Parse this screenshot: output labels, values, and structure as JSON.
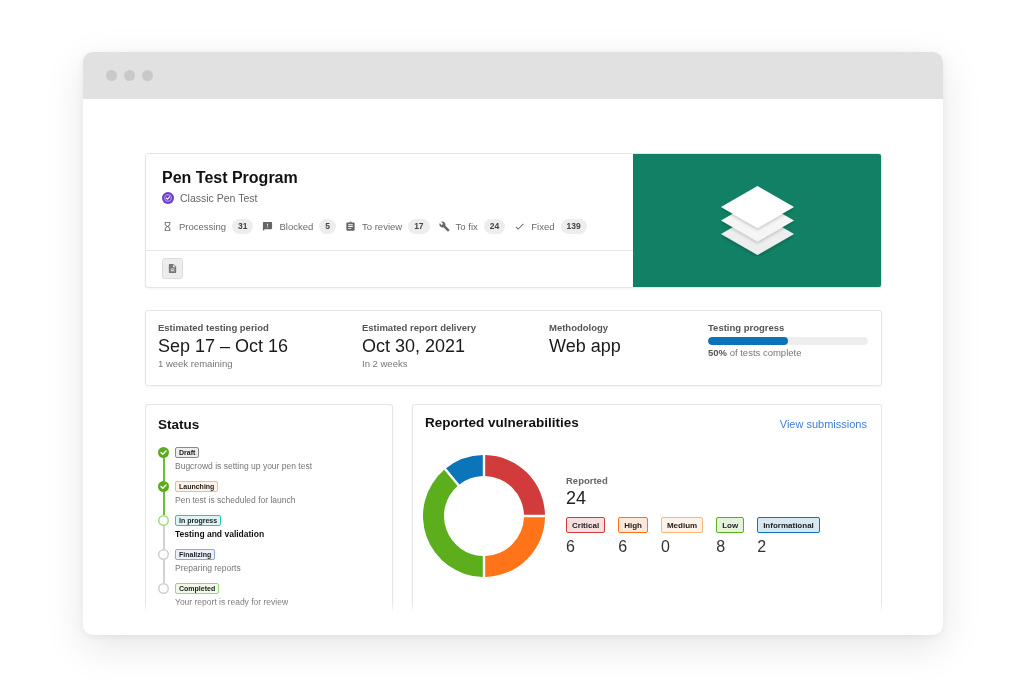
{
  "program": {
    "title": "Pen Test Program",
    "type": "Classic Pen Test",
    "stats": [
      {
        "kind": "processing",
        "label": "Processing",
        "count": "31"
      },
      {
        "kind": "blocked",
        "label": "Blocked",
        "count": "5"
      },
      {
        "kind": "review",
        "label": "To review",
        "count": "17"
      },
      {
        "kind": "fix",
        "label": "To fix",
        "count": "24"
      },
      {
        "kind": "fixed",
        "label": "Fixed",
        "count": "139"
      }
    ]
  },
  "schedule": {
    "items": [
      {
        "label": "Estimated testing period",
        "value": "Sep 17 – Oct 16",
        "note": "1 week remaining"
      },
      {
        "label": "Estimated report delivery",
        "value": "Oct 30, 2021",
        "note": "In 2 weeks"
      },
      {
        "label": "Methodology",
        "value": "Web app"
      }
    ],
    "progress": {
      "label": "Testing progress",
      "level": 0.5,
      "caption": "**50%** of tests complete"
    }
  },
  "status": {
    "title": "Status",
    "steps": [
      {
        "label": "Draft",
        "description": "Bugcrowd is setting up your pen test",
        "color": "#8a8a8a",
        "done": true,
        "current": false
      },
      {
        "label": "Launching",
        "description": "Pen test is scheduled for launch",
        "color": "#ffb870",
        "done": true,
        "current": false
      },
      {
        "label": "In progress",
        "description": "Testing and validation",
        "color": "#2ec4bb",
        "done": false,
        "current": true
      },
      {
        "label": "Finalizing",
        "description": "Preparing reports",
        "color": "#8ea6e0",
        "done": false,
        "current": false
      },
      {
        "label": "Completed",
        "description": "Your report is ready for review",
        "color": "#9bd67c",
        "done": false,
        "current": false
      }
    ]
  },
  "vulnerabilities": {
    "title": "Reported vulnerabilities",
    "link": "View submissions",
    "total_label": "Reported",
    "total": "24",
    "severities": [
      {
        "label": "Critical",
        "count": "6",
        "color": "#d23b3b"
      },
      {
        "label": "High",
        "count": "6",
        "color": "#ff7418"
      },
      {
        "label": "Medium",
        "count": "0",
        "color": "#ffb57a"
      },
      {
        "label": "Low",
        "count": "8",
        "color": "#5cae1c"
      },
      {
        "label": "Informational",
        "count": "2",
        "color": "#0c74b8"
      }
    ],
    "chart_data": {
      "type": "donut",
      "values": [
        25,
        25,
        0,
        39,
        11
      ]
    }
  }
}
